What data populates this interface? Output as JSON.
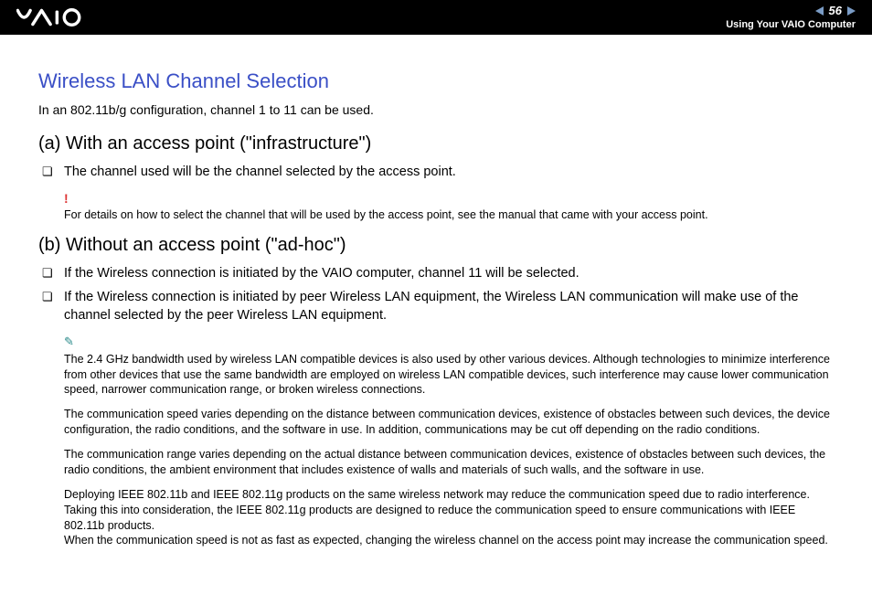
{
  "header": {
    "page_number": "56",
    "subtitle": "Using Your VAIO Computer"
  },
  "title": "Wireless LAN Channel Selection",
  "intro": "In an 802.11b/g configuration, channel 1 to 11 can be used.",
  "section_a": {
    "heading": "(a) With an access point (\"infrastructure\")",
    "bullet1": "The channel used will be the channel selected by the access point.",
    "note": "For details on how to select the channel that will be used by the access point, see the manual that came with your access point."
  },
  "section_b": {
    "heading": "(b) Without an access point (\"ad-hoc\")",
    "bullet1": "If the Wireless connection is initiated by the VAIO computer, channel 11 will be selected.",
    "bullet2": "If the Wireless connection is initiated by peer Wireless LAN equipment, the Wireless LAN communication will make use of the channel selected by the peer Wireless LAN equipment.",
    "info1": "The 2.4 GHz bandwidth used by wireless LAN compatible devices is also used by other various devices. Although technologies to minimize interference from other devices that use the same bandwidth are employed on wireless LAN compatible devices, such interference may cause lower communication speed, narrower communication range, or broken wireless connections.",
    "info2": "The communication speed varies depending on the distance between communication devices, existence of obstacles between such devices, the device configuration, the radio conditions, and the software in use. In addition, communications may be cut off depending on the radio conditions.",
    "info3": "The communication range varies depending on the actual distance between communication devices, existence of obstacles between such devices, the radio conditions, the ambient environment that includes existence of walls and materials of such walls, and the software in use.",
    "info4": "Deploying IEEE 802.11b and IEEE 802.11g products on the same wireless network may reduce the communication speed due to radio interference. Taking this into consideration, the IEEE 802.11g products are designed to reduce the communication speed to ensure communications with IEEE 802.11b products.\nWhen the communication speed is not as fast as expected, changing the wireless channel on the access point may increase the communication speed."
  }
}
